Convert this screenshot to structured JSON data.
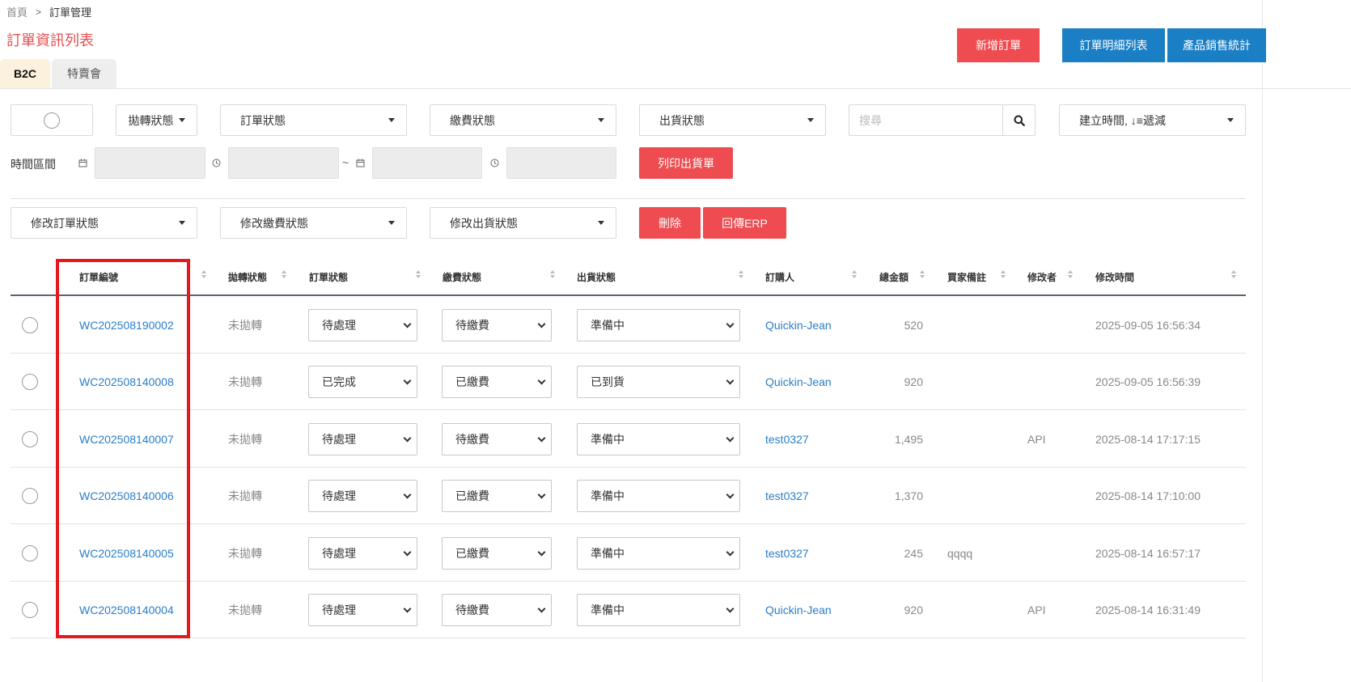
{
  "breadcrumb": {
    "home": "首頁",
    "sep": ">",
    "current": "訂單管理"
  },
  "title": "訂單資訊列表",
  "actions": {
    "new_order": "新增訂單",
    "order_detail_list": "訂單明細列表",
    "product_sales_stats": "產品銷售統計"
  },
  "tabs": [
    {
      "label": "B2C",
      "active": true
    },
    {
      "label": "特賣會",
      "active": false
    }
  ],
  "filters": {
    "transfer_status": "拋轉狀態",
    "order_status": "訂單狀態",
    "payment_status": "繳費狀態",
    "shipping_status": "出貨狀態",
    "search_placeholder": "搜尋",
    "sort": "建立時間, ↓≡遞減",
    "time_range_label": "時間區間",
    "range_sep": "~",
    "print_shipping": "列印出貨單"
  },
  "batch": {
    "edit_order_status": "修改訂單狀態",
    "edit_payment_status": "修改繳費狀態",
    "edit_shipping_status": "修改出貨狀態",
    "delete": "刪除",
    "send_erp": "回傳ERP"
  },
  "table": {
    "columns": [
      "訂單編號",
      "拋轉狀態",
      "訂單狀態",
      "繳費狀態",
      "出貨狀態",
      "訂購人",
      "總金額",
      "買家備註",
      "修改者",
      "修改時間"
    ],
    "rows": [
      {
        "order_no": "WC202508190002",
        "transfer": "未拋轉",
        "order_status": "待處理",
        "payment": "待繳費",
        "shipping": "準備中",
        "buyer": "Quickin-Jean",
        "total": "520",
        "note": "",
        "modifier": "",
        "modified": "2025-09-05 16:56:34"
      },
      {
        "order_no": "WC202508140008",
        "transfer": "未拋轉",
        "order_status": "已完成",
        "payment": "已繳費",
        "shipping": "已到貨",
        "buyer": "Quickin-Jean",
        "total": "920",
        "note": "",
        "modifier": "",
        "modified": "2025-09-05 16:56:39"
      },
      {
        "order_no": "WC202508140007",
        "transfer": "未拋轉",
        "order_status": "待處理",
        "payment": "待繳費",
        "shipping": "準備中",
        "buyer": "test0327",
        "total": "1,495",
        "note": "",
        "modifier": "API",
        "modified": "2025-08-14 17:17:15"
      },
      {
        "order_no": "WC202508140006",
        "transfer": "未拋轉",
        "order_status": "待處理",
        "payment": "已繳費",
        "shipping": "準備中",
        "buyer": "test0327",
        "total": "1,370",
        "note": "",
        "modifier": "",
        "modified": "2025-08-14 17:10:00"
      },
      {
        "order_no": "WC202508140005",
        "transfer": "未拋轉",
        "order_status": "待處理",
        "payment": "已繳費",
        "shipping": "準備中",
        "buyer": "test0327",
        "total": "245",
        "note": "qqqq",
        "modifier": "",
        "modified": "2025-08-14 16:57:17"
      },
      {
        "order_no": "WC202508140004",
        "transfer": "未拋轉",
        "order_status": "待處理",
        "payment": "待繳費",
        "shipping": "準備中",
        "buyer": "Quickin-Jean",
        "total": "920",
        "note": "",
        "modifier": "API",
        "modified": "2025-08-14 16:31:49"
      }
    ]
  },
  "colors": {
    "accent_red": "#ee4c50",
    "accent_blue": "#1b7fc6",
    "link": "#2a7ec7",
    "highlight_box": "#e3191f"
  }
}
